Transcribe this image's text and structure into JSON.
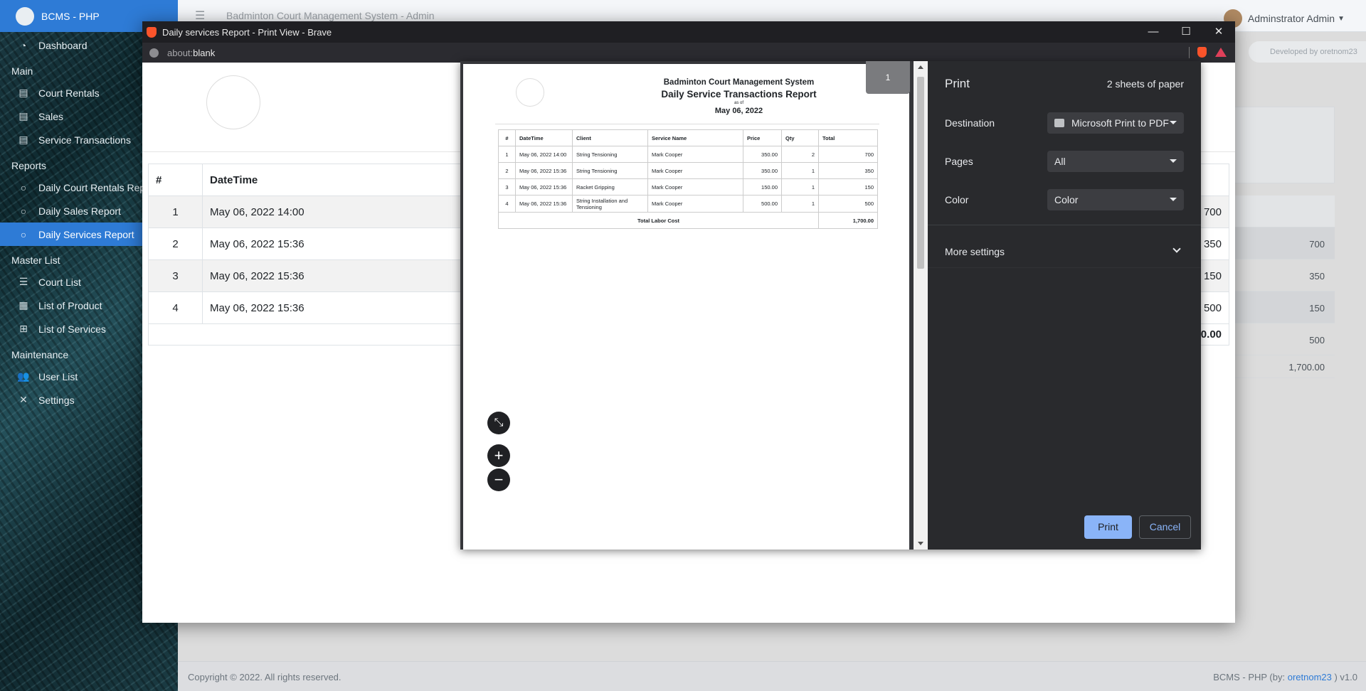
{
  "app": {
    "brand": "BCMS - PHP",
    "title": "Badminton Court Management System - Admin",
    "user": "Adminstrator Admin",
    "developed_by": "Developed by oretnom23"
  },
  "sidebar": {
    "dashboard": "Dashboard",
    "section_main": "Main",
    "court_rentals": "Court Rentals",
    "sales": "Sales",
    "service_transactions": "Service Transactions",
    "section_reports": "Reports",
    "daily_court_rentals": "Daily Court Rentals Report",
    "daily_sales": "Daily Sales Report",
    "daily_services": "Daily Services Report",
    "section_master": "Master List",
    "court_list": "Court List",
    "list_product": "List of Product",
    "list_services": "List of Services",
    "section_maintenance": "Maintenance",
    "user_list": "User List",
    "settings": "Settings"
  },
  "footer": {
    "copyright": "Copyright © 2022. All rights reserved.",
    "version_prefix": "BCMS - PHP (by: ",
    "author": "oretnom23",
    "version_suffix": " ) v1.0"
  },
  "bg_totals": [
    "700",
    "350",
    "150",
    "500"
  ],
  "bg_grand_total": "1,700.00",
  "popup": {
    "window_title": "Daily services Report - Print View - Brave",
    "url_scheme": "about:",
    "url_rest": "blank",
    "minimize": "—",
    "maximize": "☐",
    "close": "✕"
  },
  "report_page": {
    "col_num": "#",
    "col_datetime": "DateTime",
    "col_total": "Total",
    "rows": [
      {
        "num": "1",
        "datetime": "May 06, 2022 14:00",
        "total": "700"
      },
      {
        "num": "2",
        "datetime": "May 06, 2022 15:36",
        "total": "350"
      },
      {
        "num": "3",
        "datetime": "May 06, 2022 15:36",
        "total": "150"
      },
      {
        "num": "4",
        "datetime": "May 06, 2022 15:36",
        "total": "500"
      }
    ],
    "grand_total": "1,700.00"
  },
  "document": {
    "system_name": "Badminton Court Management System",
    "report_title": "Daily Service Transactions Report",
    "as_of_label": "as of",
    "date": "May 06, 2022",
    "headers": [
      "#",
      "DateTime",
      "Client",
      "Service Name",
      "Price",
      "Qty",
      "Total"
    ],
    "rows": [
      [
        "1",
        "May 06, 2022 14:00",
        "String Tensioning",
        "Mark Cooper",
        "350.00",
        "2",
        "700"
      ],
      [
        "2",
        "May 06, 2022 15:36",
        "String Tensioning",
        "Mark Cooper",
        "350.00",
        "1",
        "350"
      ],
      [
        "3",
        "May 06, 2022 15:36",
        "Racket Gripping",
        "Mark Cooper",
        "150.00",
        "1",
        "150"
      ],
      [
        "4",
        "May 06, 2022 15:36",
        "String Installation and Tensioning",
        "Mark Cooper",
        "500.00",
        "1",
        "500"
      ]
    ],
    "total_label": "Total Labor Cost",
    "total_value": "1,700.00"
  },
  "print_dialog": {
    "title": "Print",
    "sheets": "2 sheets of paper",
    "page_badge": "1",
    "destination_label": "Destination",
    "destination_value": "Microsoft Print to PDF",
    "pages_label": "Pages",
    "pages_value": "All",
    "color_label": "Color",
    "color_value": "Color",
    "more_settings": "More settings",
    "print_button": "Print",
    "cancel_button": "Cancel",
    "fit_icon": "⤡",
    "zoom_in": "+",
    "zoom_out": "−"
  }
}
